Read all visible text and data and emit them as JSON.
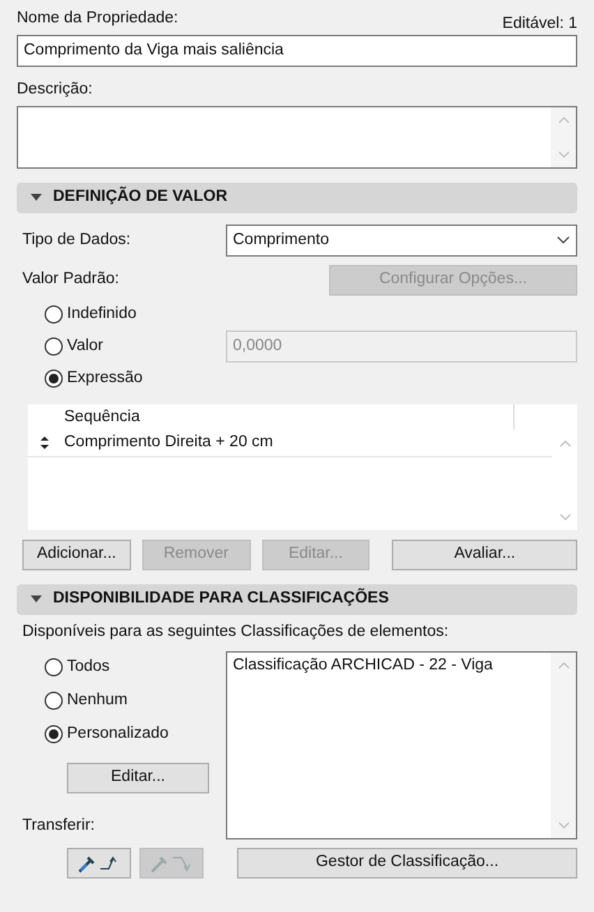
{
  "property_name": {
    "label": "Nome da Propriedade:",
    "value": "Comprimento da Viga mais saliência"
  },
  "editable": "Editável: 1",
  "description": {
    "label": "Descrição:"
  },
  "value_definition": {
    "title": "DEFINIÇÃO DE VALOR",
    "expanded": true,
    "data_type": {
      "label": "Tipo de Dados:",
      "value": "Comprimento"
    },
    "default_label": "Valor Padrão:",
    "configure_button": {
      "label": "Configurar Opções...",
      "disabled": true
    },
    "options": [
      {
        "label": "Indefinido",
        "selected": false
      },
      {
        "label": "Valor",
        "selected": false,
        "field": {
          "value": "0,0000",
          "disabled": true
        }
      },
      {
        "label": "Expressão",
        "selected": true
      }
    ],
    "table": {
      "column_1": "Sequência",
      "rows": [
        {
          "text": "Comprimento Direita + 20 cm"
        }
      ]
    },
    "buttons": [
      {
        "label": "Adicionar...",
        "disabled": false
      },
      {
        "label": "Remover",
        "disabled": true
      },
      {
        "label": "Editar...",
        "disabled": true
      },
      {
        "label": "Avaliar...",
        "disabled": false
      }
    ]
  },
  "classifications": {
    "title": "DISPONIBILIDADE PARA CLASSIFICAÇÕES",
    "expanded": true,
    "intro": "Disponíveis para as seguintes Classificações de elementos:",
    "options": [
      {
        "label": "Todos",
        "selected": false
      },
      {
        "label": "Nenhum",
        "selected": false
      },
      {
        "label": "Personalizado",
        "selected": true
      }
    ],
    "edit_button": {
      "label": "Editar...",
      "disabled": false
    },
    "items": [
      "Classificação ARCHICAD - 22 - Viga"
    ],
    "transfer_label": "Transferir:",
    "transfer_buttons": [
      {
        "kind": "pick",
        "disabled": false
      },
      {
        "kind": "inject",
        "disabled": true
      }
    ],
    "manager_button": {
      "label": "Gestor de Classificação...",
      "disabled": false
    }
  }
}
